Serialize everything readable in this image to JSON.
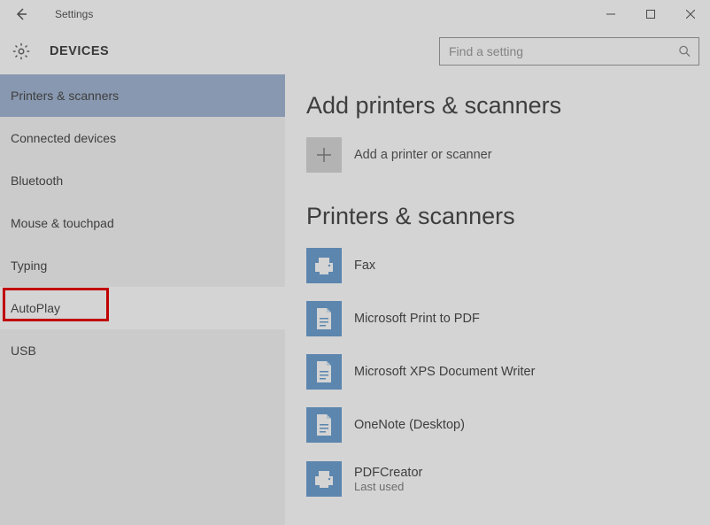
{
  "titlebar": {
    "title": "Settings"
  },
  "header": {
    "crumb": "DEVICES",
    "search_placeholder": "Find a setting"
  },
  "sidebar": {
    "items": [
      {
        "label": "Printers & scanners",
        "selected": true
      },
      {
        "label": "Connected devices"
      },
      {
        "label": "Bluetooth"
      },
      {
        "label": "Mouse & touchpad"
      },
      {
        "label": "Typing"
      },
      {
        "label": "AutoPlay",
        "highlighted": true
      },
      {
        "label": "USB"
      }
    ]
  },
  "main": {
    "add_heading": "Add printers & scanners",
    "add_label": "Add a printer or scanner",
    "list_heading": "Printers & scanners",
    "devices": [
      {
        "name": "Fax",
        "icon": "fax"
      },
      {
        "name": "Microsoft Print to PDF",
        "icon": "pdf"
      },
      {
        "name": "Microsoft XPS Document Writer",
        "icon": "pdf"
      },
      {
        "name": "OneNote (Desktop)",
        "icon": "pdf"
      },
      {
        "name": "PDFCreator",
        "icon": "fax",
        "sub": "Last used"
      }
    ]
  },
  "colors": {
    "accent": "#4f8dc7",
    "sidebar_selected": "#8fa7ca"
  }
}
